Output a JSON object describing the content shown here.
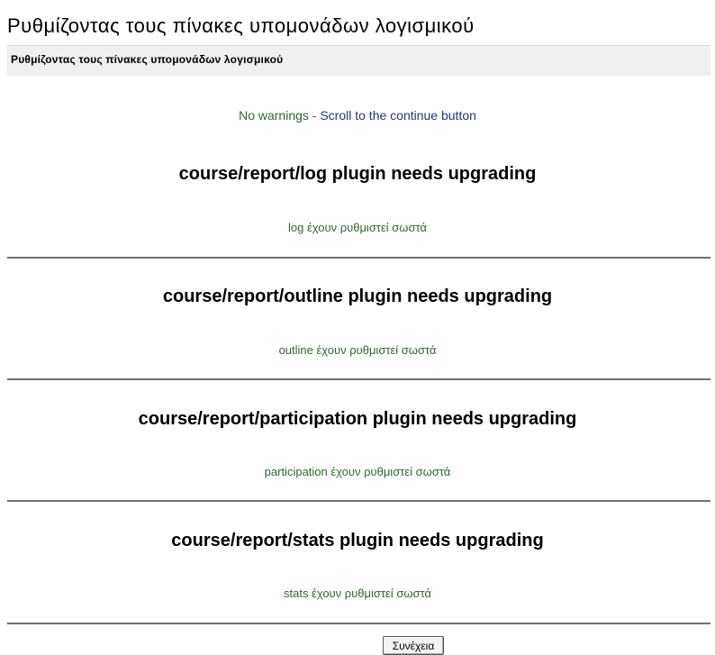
{
  "page": {
    "title": "Ρυθμίζοντας τους πίνακες υπομονάδων λογισμικού",
    "header_bar_text": "Ρυθμίζοντας τους πίνακες υπομονάδων λογισμικού",
    "notice_prefix": "No warnings - ",
    "notice_link": "Scroll to the continue button"
  },
  "sections": [
    {
      "heading": "course/report/log plugin needs upgrading",
      "status": "log έχουν ρυθμιστεί σωστά"
    },
    {
      "heading": "course/report/outline plugin needs upgrading",
      "status": "outline έχουν ρυθμιστεί σωστά"
    },
    {
      "heading": "course/report/participation plugin needs upgrading",
      "status": "participation έχουν ρυθμιστεί σωστά"
    },
    {
      "heading": "course/report/stats plugin needs upgrading",
      "status": "stats έχουν ρυθμιστεί σωστά"
    }
  ],
  "continue_button": {
    "label": "Συνέχεια"
  },
  "colors": {
    "status_text": "#2d6a2d",
    "link_text": "#22347a",
    "header_bar_bg": "#efefef",
    "divider": "#707070"
  }
}
